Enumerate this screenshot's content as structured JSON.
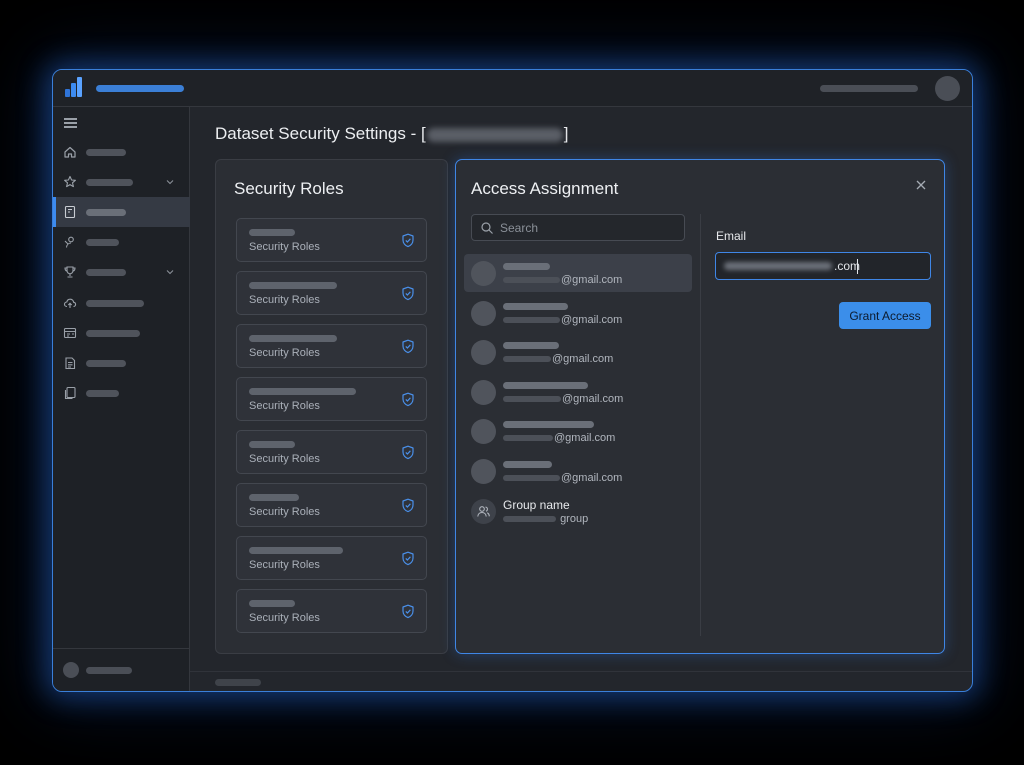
{
  "page": {
    "title": "Dataset Security Settings - [",
    "title_suffix": "]"
  },
  "roles_panel": {
    "title": "Security Roles",
    "roles": [
      {
        "label": "Security Roles"
      },
      {
        "label": "Security Roles"
      },
      {
        "label": "Security Roles"
      },
      {
        "label": "Security Roles"
      },
      {
        "label": "Security Roles"
      },
      {
        "label": "Security Roles"
      },
      {
        "label": "Security Roles"
      },
      {
        "label": "Security Roles"
      }
    ]
  },
  "access_panel": {
    "title": "Access Assignment",
    "search": {
      "placeholder": "Search",
      "value": ""
    },
    "users": [
      {
        "email_domain": "@gmail.com",
        "selected": true
      },
      {
        "email_domain": "@gmail.com"
      },
      {
        "email_domain": "@gmail.com"
      },
      {
        "email_domain": "@gmail.com"
      },
      {
        "email_domain": "@gmail.com"
      },
      {
        "email_domain": "@gmail.com"
      }
    ],
    "group": {
      "name": "Group name",
      "subtitle": "group"
    },
    "email": {
      "label": "Email",
      "value_suffix": ".com"
    },
    "grant_label": "Grant Access"
  },
  "icons": {
    "nav": [
      "home-icon",
      "star-icon",
      "dataset-icon",
      "users-icon",
      "trophy-icon",
      "cloud-upload-icon",
      "reports-icon",
      "notes-icon",
      "files-icon"
    ],
    "role": "shield-check-icon",
    "close": "close-icon",
    "search": "search-icon",
    "group": "group-icon"
  },
  "colors": {
    "accent": "#3d8bf0",
    "glow": "#3a7fd9",
    "button": "#3b8eea",
    "background": "#23262c"
  }
}
